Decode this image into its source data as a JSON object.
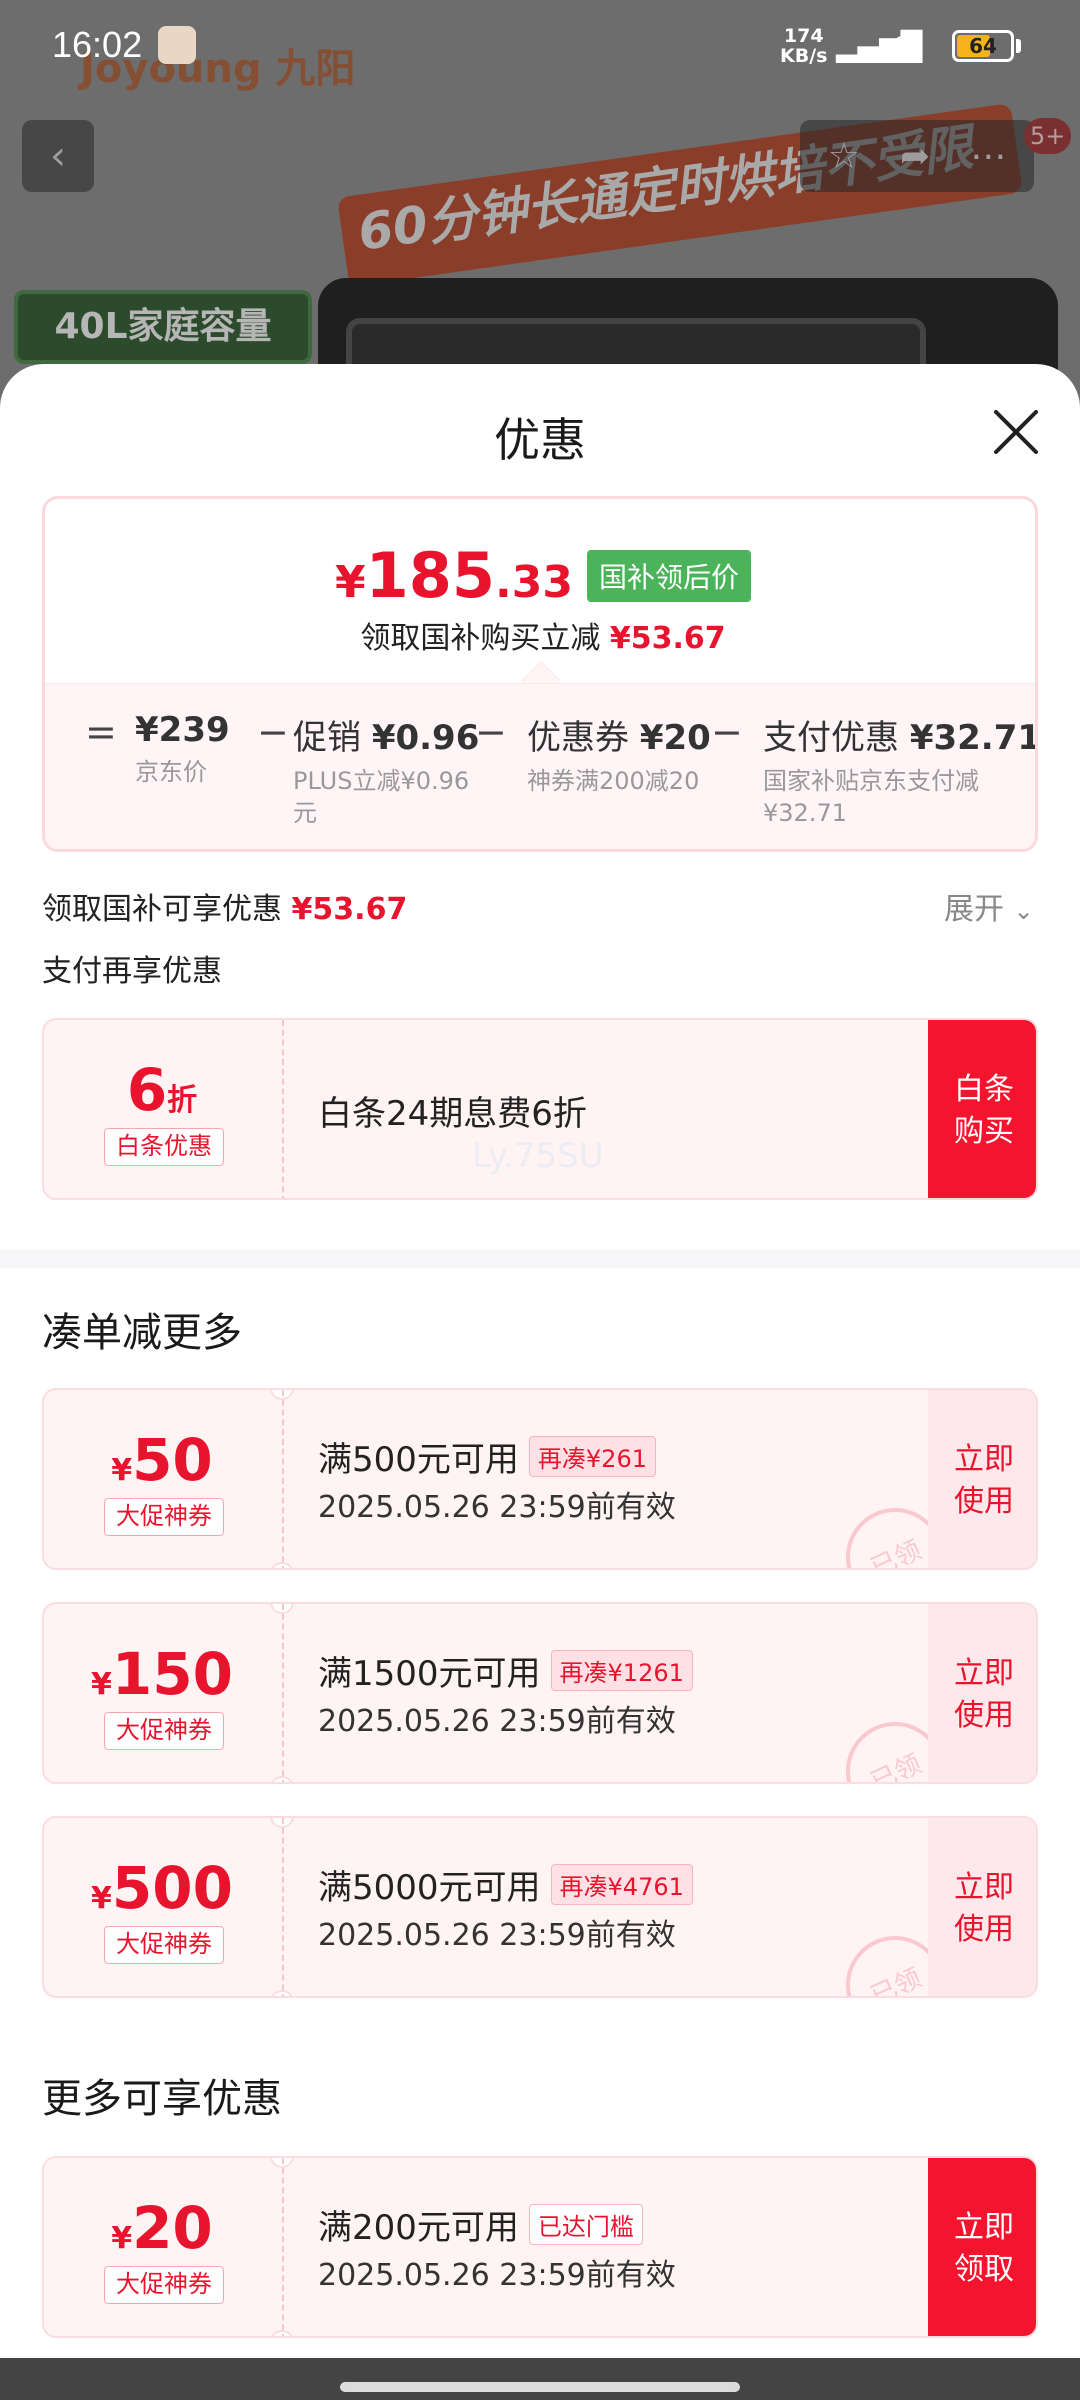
{
  "status_bar": {
    "time": "16:02",
    "net_speed_value": "174",
    "net_speed_unit": "KB/s",
    "network": "HD",
    "battery": "64"
  },
  "background": {
    "brand": "Joyoung 九阳",
    "slogan": "60分钟长通定时烘培不受限",
    "capacity": "40L家庭容量",
    "cart_badge": "5+"
  },
  "sheet": {
    "title": "优惠",
    "price": {
      "yen": "¥",
      "int": "185",
      "dec": ".33",
      "tag": "国补领后价",
      "sub_prefix": "领取国补购买立减",
      "sub_amount": "¥53.67"
    },
    "breakdown": [
      {
        "op": "=",
        "main": "¥239",
        "desc": "京东价"
      },
      {
        "op": "−",
        "main_label": "促销",
        "main_value": "¥0.96",
        "desc": "PLUS立减¥0.96元"
      },
      {
        "op": "−",
        "main_label": "优惠券",
        "main_value": "¥20",
        "desc": "神券满200减20"
      },
      {
        "op": "−",
        "main_label": "支付优惠",
        "main_value": "¥32.71",
        "desc": "国家补贴京东支付减¥32.71"
      }
    ],
    "subsidy_line": {
      "label": "领取国补可享优惠",
      "amount": "¥53.67",
      "expand": "展开"
    },
    "pay_section_title": "支付再享优惠",
    "baitiao": {
      "amount": "6",
      "unit": "折",
      "tag": "白条优惠",
      "title": "白条24期息费6折",
      "watermark": "Ly.75SU",
      "action": "白条购买"
    },
    "more_title": "凑单减更多",
    "coupons": [
      {
        "amount": "50",
        "tag": "大促神券",
        "title": "满500元可用",
        "chip": "再凑¥261",
        "date": "2025.05.26 23:59前有效",
        "action": "立即使用",
        "stamp": "已领"
      },
      {
        "amount": "150",
        "tag": "大促神券",
        "title": "满1500元可用",
        "chip": "再凑¥1261",
        "date": "2025.05.26 23:59前有效",
        "action": "立即使用",
        "stamp": "已领"
      },
      {
        "amount": "500",
        "tag": "大促神券",
        "title": "满5000元可用",
        "chip": "再凑¥4761",
        "date": "2025.05.26 23:59前有效",
        "action": "立即使用",
        "stamp": "已领"
      }
    ],
    "extra_title": "更多可享优惠",
    "extra_coupon": {
      "amount": "20",
      "tag": "大促神券",
      "title": "满200元可用",
      "chip": "已达门槛",
      "date": "2025.05.26 23:59前有效",
      "action": "立即领取"
    }
  },
  "colors": {
    "accent_red": "#e8142e",
    "tag_green": "#4bb35a",
    "battery": "#f5b21b"
  }
}
